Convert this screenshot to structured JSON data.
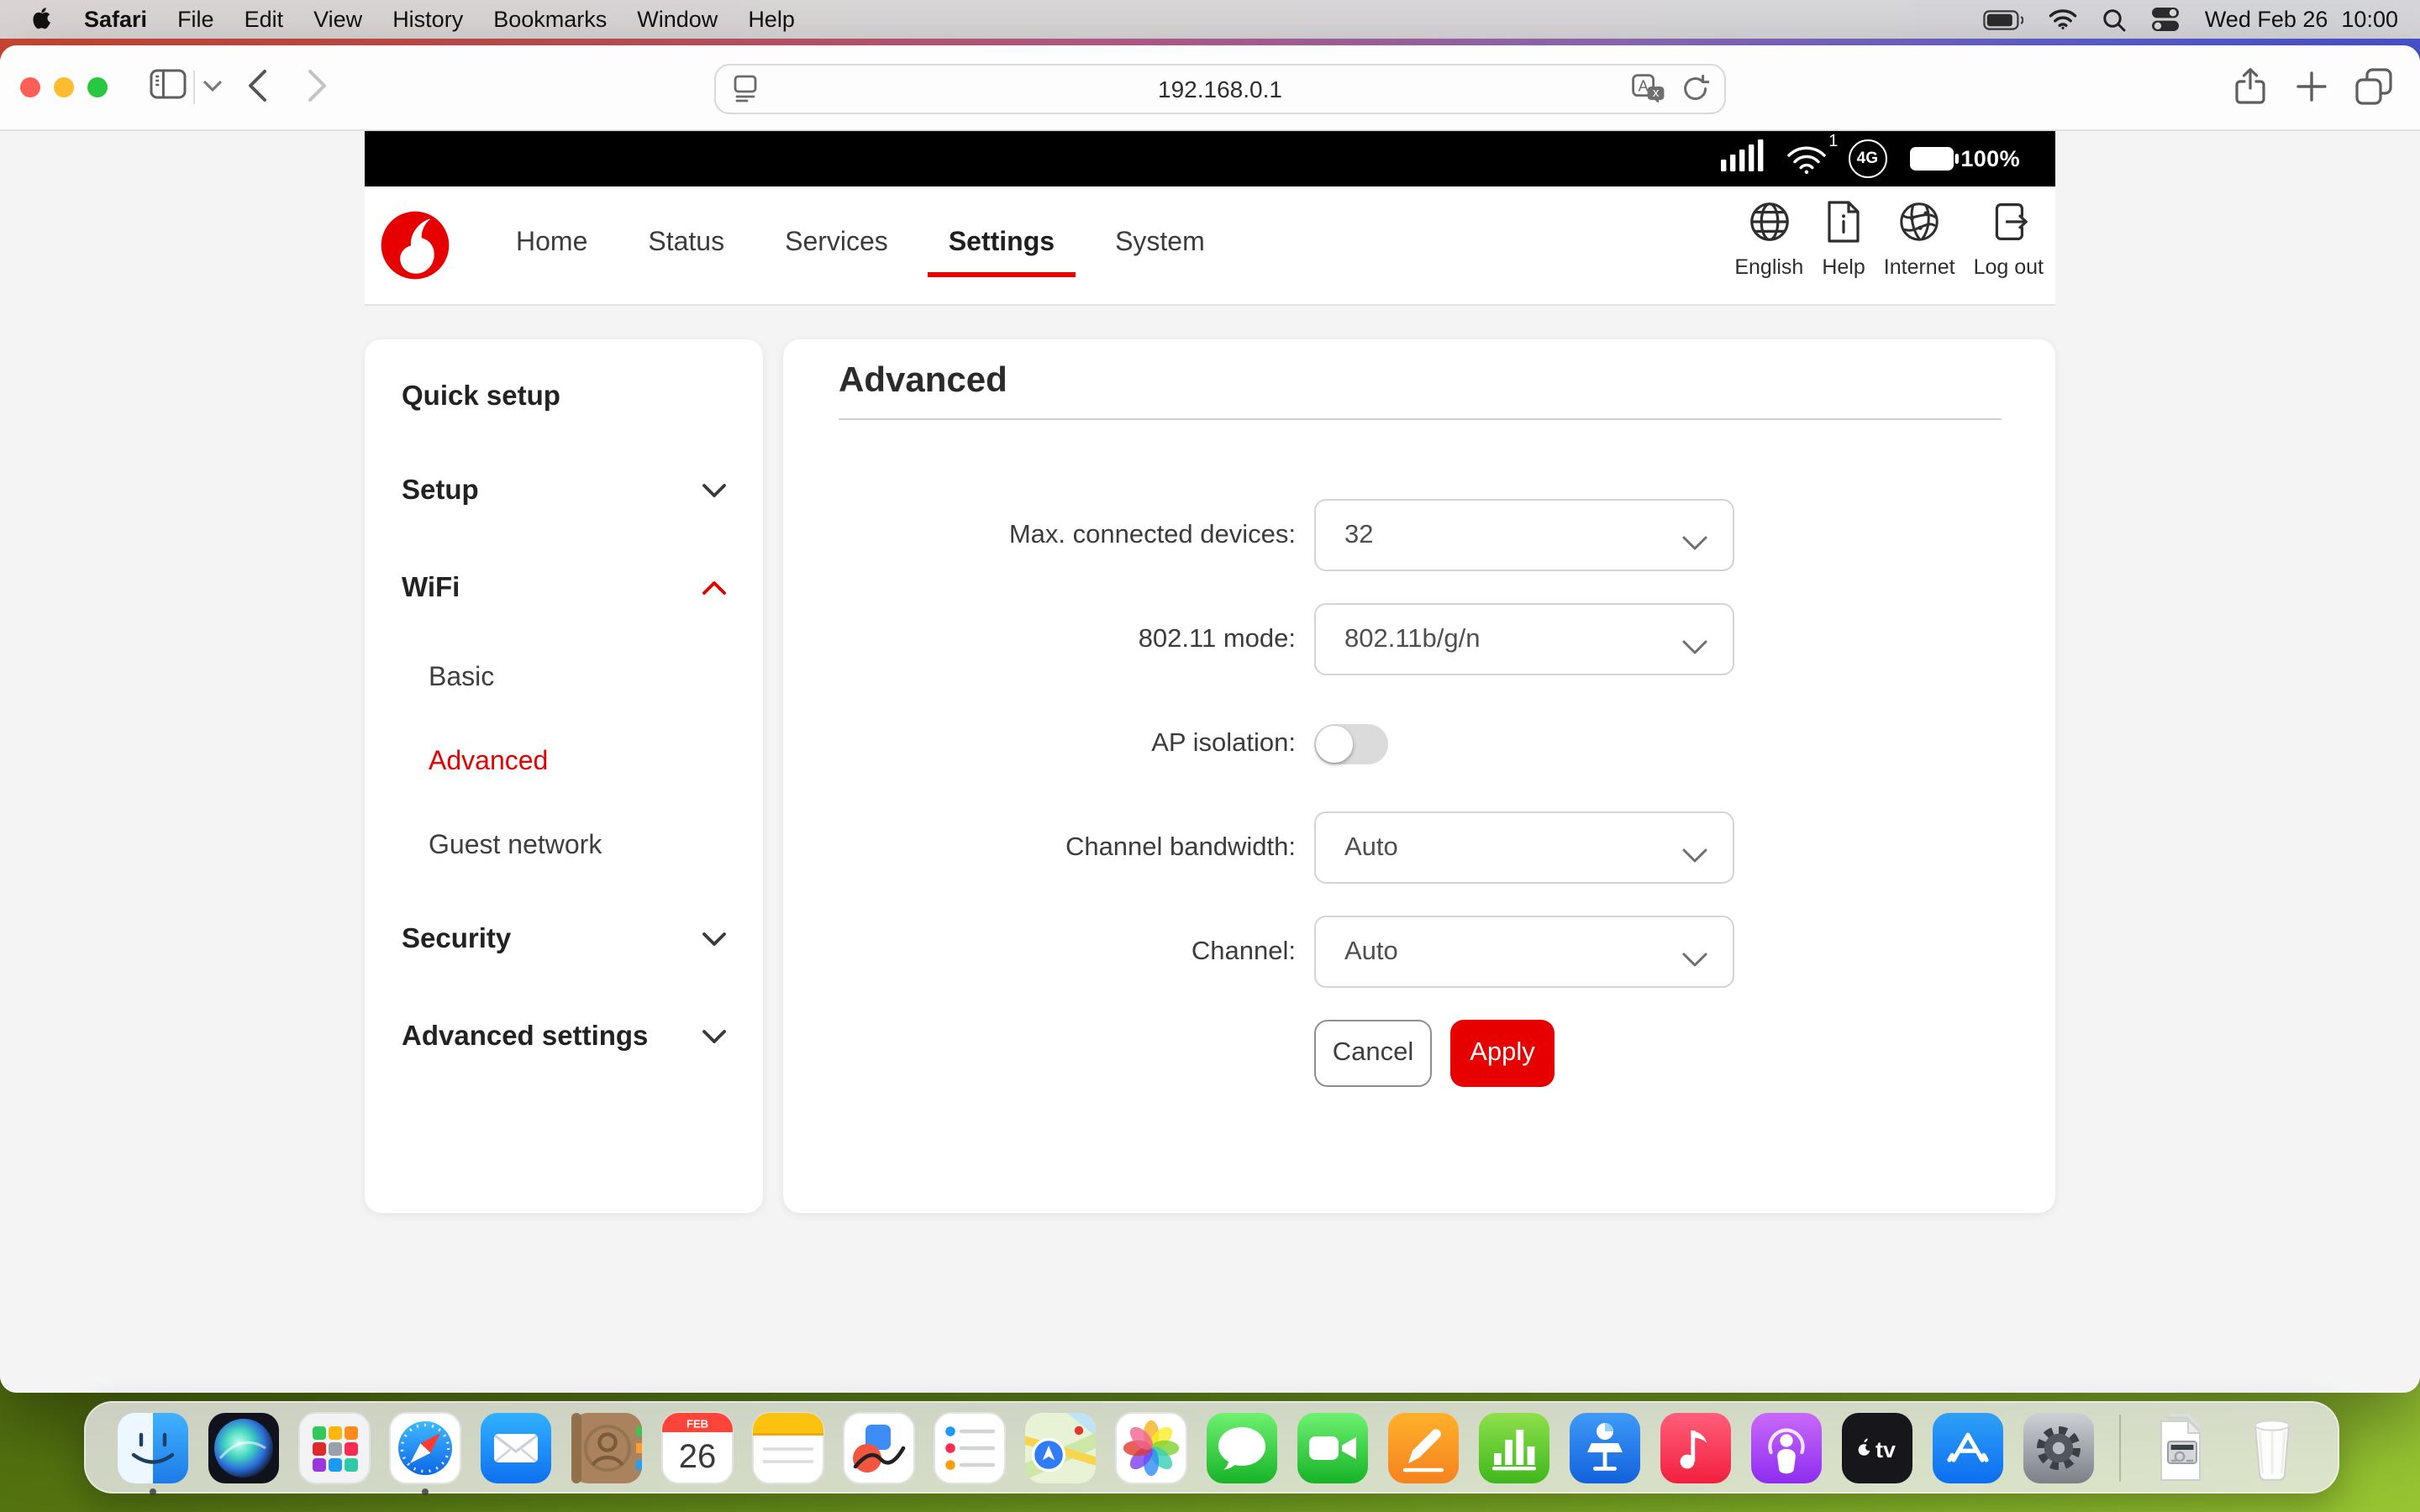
{
  "theme": {
    "accent": "#e60000",
    "dock_green_wall": "#7fae25",
    "top_wall_left": "#cc4733",
    "top_wall_right": "#4953d0"
  },
  "menu_bar": {
    "app_name": "Safari",
    "items": [
      "File",
      "Edit",
      "View",
      "History",
      "Bookmarks",
      "Window",
      "Help"
    ],
    "status_icons": [
      "battery-icon",
      "wifi-icon",
      "spotlight-search-icon",
      "control-center-icon"
    ],
    "clock_date": "Wed Feb 26",
    "clock_time": "10:00"
  },
  "browser": {
    "url": "192.168.0.1",
    "toolbar_icons": [
      "sidebar-icon",
      "chevron-down-icon",
      "back-icon",
      "forward-icon",
      "page-menu-icon",
      "translate-icon",
      "reload-icon",
      "share-icon",
      "new-tab-icon",
      "tab-overview-icon"
    ]
  },
  "device_bar": {
    "signal_icon": "cell-signal-icon",
    "wifi_icon": "wifi-icon",
    "wifi_superscript": "1",
    "network_badge": "4G",
    "battery_icon": "battery-icon",
    "battery_label": "100%"
  },
  "site_header": {
    "brand_icon": "vodafone-logo",
    "nav": [
      "Home",
      "Status",
      "Services",
      "Settings",
      "System"
    ],
    "active_nav": "Settings",
    "utility_links": [
      {
        "icon": "globe-icon",
        "label": "English"
      },
      {
        "icon": "help-document-icon",
        "label": "Help"
      },
      {
        "icon": "internet-globe-icon",
        "label": "Internet"
      },
      {
        "icon": "logout-icon",
        "label": "Log out"
      }
    ]
  },
  "sidebar": {
    "items": [
      {
        "label": "Quick setup",
        "level": 1
      },
      {
        "label": "Setup",
        "level": 1,
        "chevron": "down"
      },
      {
        "label": "WiFi",
        "level": 1,
        "chevron": "up",
        "expanded": true
      },
      {
        "label": "Basic",
        "level": 2
      },
      {
        "label": "Advanced",
        "level": 2,
        "active": true
      },
      {
        "label": "Guest network",
        "level": 2
      },
      {
        "label": "Security",
        "level": 1,
        "chevron": "down"
      },
      {
        "label": "Advanced settings",
        "level": 1,
        "chevron": "down"
      }
    ]
  },
  "content": {
    "title": "Advanced",
    "rows": [
      {
        "label": "Max. connected devices:",
        "control": "select",
        "value": "32"
      },
      {
        "label": "802.11 mode:",
        "control": "select",
        "value": "802.11b/g/n"
      },
      {
        "label": "AP isolation:",
        "control": "toggle",
        "value": "off"
      },
      {
        "label": "Channel bandwidth:",
        "control": "select",
        "value": "Auto"
      },
      {
        "label": "Channel:",
        "control": "select",
        "value": "Auto"
      }
    ],
    "cancel_label": "Cancel",
    "apply_label": "Apply"
  },
  "dock": {
    "items": [
      {
        "name": "finder",
        "running": true
      },
      {
        "name": "siri"
      },
      {
        "name": "launchpad"
      },
      {
        "name": "safari",
        "running": true
      },
      {
        "name": "mail"
      },
      {
        "name": "contacts"
      },
      {
        "name": "calendar"
      },
      {
        "name": "notes"
      },
      {
        "name": "freeform"
      },
      {
        "name": "reminders"
      },
      {
        "name": "maps"
      },
      {
        "name": "photos"
      },
      {
        "name": "messages"
      },
      {
        "name": "facetime"
      },
      {
        "name": "pages"
      },
      {
        "name": "numbers"
      },
      {
        "name": "keynote"
      },
      {
        "name": "music"
      },
      {
        "name": "podcasts"
      },
      {
        "name": "tv"
      },
      {
        "name": "app-store"
      },
      {
        "name": "system-settings"
      },
      {
        "name": "divider"
      },
      {
        "name": "documents-stack"
      },
      {
        "name": "trash"
      }
    ],
    "calendar_month": "FEB",
    "calendar_day": "26"
  }
}
